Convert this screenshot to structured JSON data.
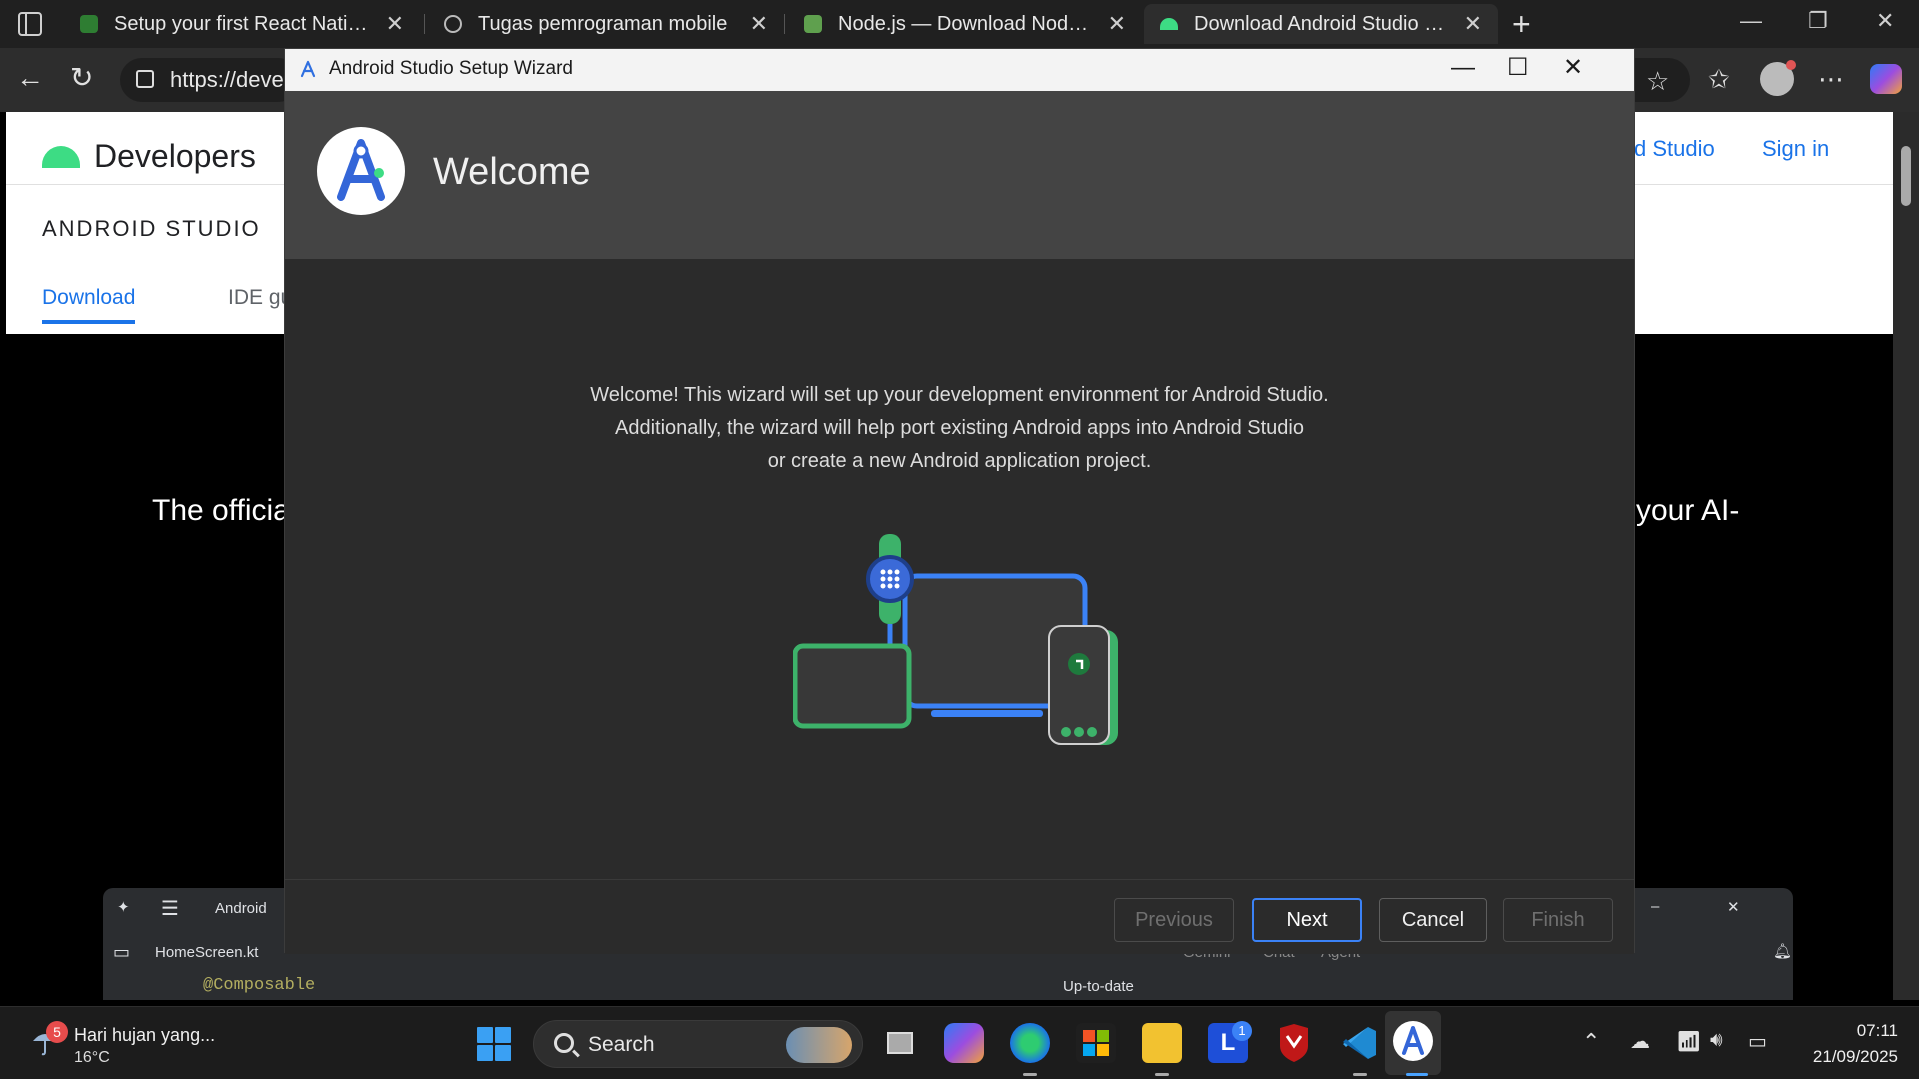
{
  "browser": {
    "tabs": [
      {
        "title": "Setup your first React Native App",
        "active": false
      },
      {
        "title": "Tugas pemrograman mobile",
        "active": false
      },
      {
        "title": "Node.js — Download Node.js®",
        "active": false
      },
      {
        "title": "Download Android Studio & App",
        "active": true
      }
    ],
    "address": "https://deve"
  },
  "webpage": {
    "logo_text": "Developers",
    "section_title": "ANDROID STUDIO",
    "tabs": [
      "Download",
      "IDE gu"
    ],
    "header_links": [
      "d Studio",
      "Sign in"
    ],
    "hero_left": "The officia",
    "hero_right": "your AI-",
    "ide": {
      "project": "Android",
      "file_tab": "HomeScreen.kt",
      "code": "@Composable",
      "status": "Up-to-date",
      "panel_tabs": [
        "Gemini",
        "Chat",
        "Agent"
      ]
    }
  },
  "wizard": {
    "window_title": "Android Studio Setup Wizard",
    "heading": "Welcome",
    "paragraph": [
      "Welcome! This wizard will set up your development environment for Android Studio.",
      "Additionally, the wizard will help port existing Android apps into Android Studio",
      "or create a new Android application project."
    ],
    "buttons": {
      "previous": "Previous",
      "next": "Next",
      "cancel": "Cancel",
      "finish": "Finish"
    }
  },
  "taskbar": {
    "weather_title": "Hari hujan yang...",
    "weather_temp": "16°C",
    "weather_badge": "5",
    "search_label": "Search",
    "app_badge": "1",
    "time": "07:11",
    "date": "21/09/2025"
  },
  "colors": {
    "accent": "#3b82f6",
    "android_green": "#3ddc84",
    "link_blue": "#1a73e8"
  }
}
